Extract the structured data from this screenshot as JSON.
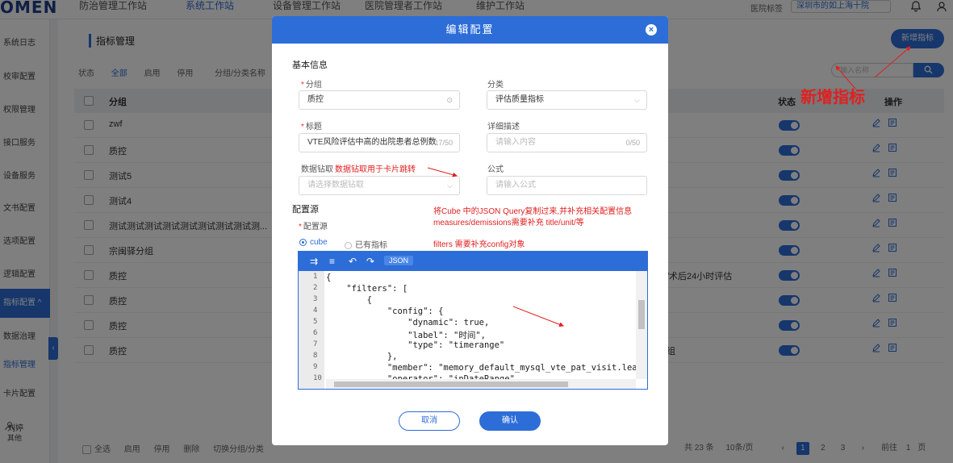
{
  "app": {
    "logo": "OMEN",
    "nav_tabs": [
      "防治管理工作站",
      "系统工作站",
      "设备管理工作站",
      "医院管理者工作站",
      "维护工作站"
    ],
    "active_tab_index": 1,
    "hospital_label": "医院标签",
    "hospital_value": "深圳市的如上海十院"
  },
  "sidebar": {
    "items": [
      "系统日志",
      "校审配置",
      "权限管理",
      "接口服务",
      "设备服务",
      "文书配置",
      "选项配置",
      "逻辑配置",
      "指标配置",
      "数据治理",
      "指标管理",
      "卡片配置"
    ],
    "active_label": "指标配置",
    "user_name": "刘婷",
    "user_role": "其他"
  },
  "main": {
    "page_title": "指标管理",
    "add_button": "新增指标",
    "filter": {
      "label": "状态",
      "options": [
        "全部",
        "启用",
        "停用"
      ],
      "active": "全部",
      "group_label": "分组/分类名称"
    },
    "search_placeholder": "输入名称",
    "table": {
      "headers": {
        "group": "分组",
        "status": "状态",
        "ops": "操作"
      },
      "rows": [
        {
          "name": "zwf",
          "extra": ""
        },
        {
          "name": "质控",
          "extra": ""
        },
        {
          "name": "测试5",
          "extra": ""
        },
        {
          "name": "测试4",
          "extra": ""
        },
        {
          "name": "测试测试测试测试测试测试测试测试测...",
          "extra": ""
        },
        {
          "name": "宗闽驿分组",
          "extra": ""
        },
        {
          "name": "质控",
          "extra": "/术后24小时评估"
        },
        {
          "name": "质控",
          "extra": ""
        },
        {
          "name": "质控",
          "extra": ""
        },
        {
          "name": "质控",
          "extra": "组"
        }
      ]
    },
    "footer_actions": [
      "全选",
      "启用",
      "停用",
      "删除",
      "切换分组/分类"
    ],
    "pager": {
      "total": "共 23 条",
      "page_size": "10条/页",
      "pages": [
        "1",
        "2",
        "3"
      ],
      "current": "1",
      "goto_label": "前往",
      "goto_value": "1",
      "goto_suffix": "页"
    }
  },
  "modal": {
    "title": "编辑配置",
    "basic_info": "基本信息",
    "group": {
      "label": "分组",
      "value": "质控"
    },
    "category": {
      "label": "分类",
      "value": "评估质量指标"
    },
    "title_field": {
      "label": "标题",
      "value": "VTE风险评估中高的出院患者总例数",
      "count": "17/50"
    },
    "description": {
      "label": "详细描述",
      "placeholder": "请输入内容",
      "count": "0/50"
    },
    "data_source": {
      "label": "数据钻取",
      "placeholder": "请选择数据钻取"
    },
    "formula": {
      "label": "公式",
      "placeholder": "请输入公式"
    },
    "config_source_title": "配置源",
    "config_source_label": "配置源",
    "source_options": [
      "cube",
      "已有指标"
    ],
    "source_selected": "cube",
    "editor": {
      "mode": "JSON",
      "lines": [
        "{",
        "    \"filters\": [",
        "        {",
        "            \"config\": {",
        "                \"dynamic\": true,",
        "                \"label\": \"时间\",",
        "                \"type\": \"timerange\"",
        "            },",
        "            \"member\": \"memory_default_mysql_vte_pat_visit.lea",
        "            \"operator\": \"inDateRange\","
      ],
      "line_numbers": [
        "1",
        "2",
        "3",
        "4",
        "5",
        "6",
        "7",
        "8",
        "9",
        "10"
      ]
    },
    "cancel_button": "取消",
    "confirm_button": "确认"
  },
  "annotations": {
    "add_indicator": "新增指标",
    "drill_note": "数据钻取用于卡片跳转",
    "cube_note_1": "将Cube 中的JSON Query复制过来,并补充相关配置信息",
    "cube_note_2": "measures/demissions需要补充 title/unit/等",
    "cube_note_3": "filters 需要补充config对象"
  },
  "colors": {
    "primary": "#2d6dd8",
    "annotation_red": "#e02020"
  }
}
